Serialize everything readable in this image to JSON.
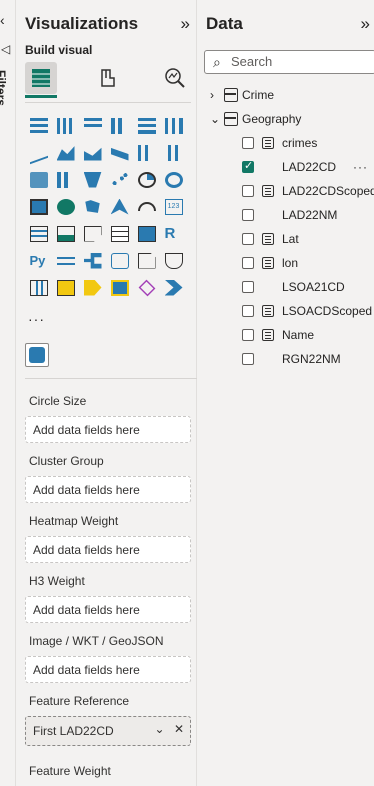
{
  "filters": {
    "label": "Filters"
  },
  "visualizations": {
    "title": "Visualizations",
    "build_visual_label": "Build visual",
    "more_label": "···",
    "wells": [
      {
        "title": "Circle Size",
        "value": "Add data fields here",
        "filled": false
      },
      {
        "title": "Cluster Group",
        "value": "Add data fields here",
        "filled": false
      },
      {
        "title": "Heatmap Weight",
        "value": "Add data fields here",
        "filled": false
      },
      {
        "title": "H3 Weight",
        "value": "Add data fields here",
        "filled": false
      },
      {
        "title": "Image / WKT / GeoJSON",
        "value": "Add data fields here",
        "filled": false
      },
      {
        "title": "Feature Reference",
        "value": "First LAD22CD",
        "filled": true
      },
      {
        "title": "Feature Weight",
        "value": "",
        "filled": false
      }
    ]
  },
  "data_pane": {
    "title": "Data",
    "search_placeholder": "Search",
    "tables": [
      {
        "name": "Crime",
        "expanded": false
      },
      {
        "name": "Geography",
        "expanded": true
      }
    ],
    "fields": [
      {
        "name": "crimes",
        "checked": false,
        "calc": true
      },
      {
        "name": "LAD22CD",
        "checked": true,
        "calc": false
      },
      {
        "name": "LAD22CDScoped",
        "checked": false,
        "calc": true
      },
      {
        "name": "LAD22NM",
        "checked": false,
        "calc": false
      },
      {
        "name": "Lat",
        "checked": false,
        "calc": true
      },
      {
        "name": "lon",
        "checked": false,
        "calc": true
      },
      {
        "name": "LSOA21CD",
        "checked": false,
        "calc": false
      },
      {
        "name": "LSOACDScoped",
        "checked": false,
        "calc": true
      },
      {
        "name": "Name",
        "checked": false,
        "calc": true
      },
      {
        "name": "RGN22NM",
        "checked": false,
        "calc": false
      }
    ],
    "field_more_label": "···"
  },
  "colors": {
    "accent": "#117865",
    "pane_bg": "#f3f2f1",
    "bar": "#2a7ab0"
  }
}
